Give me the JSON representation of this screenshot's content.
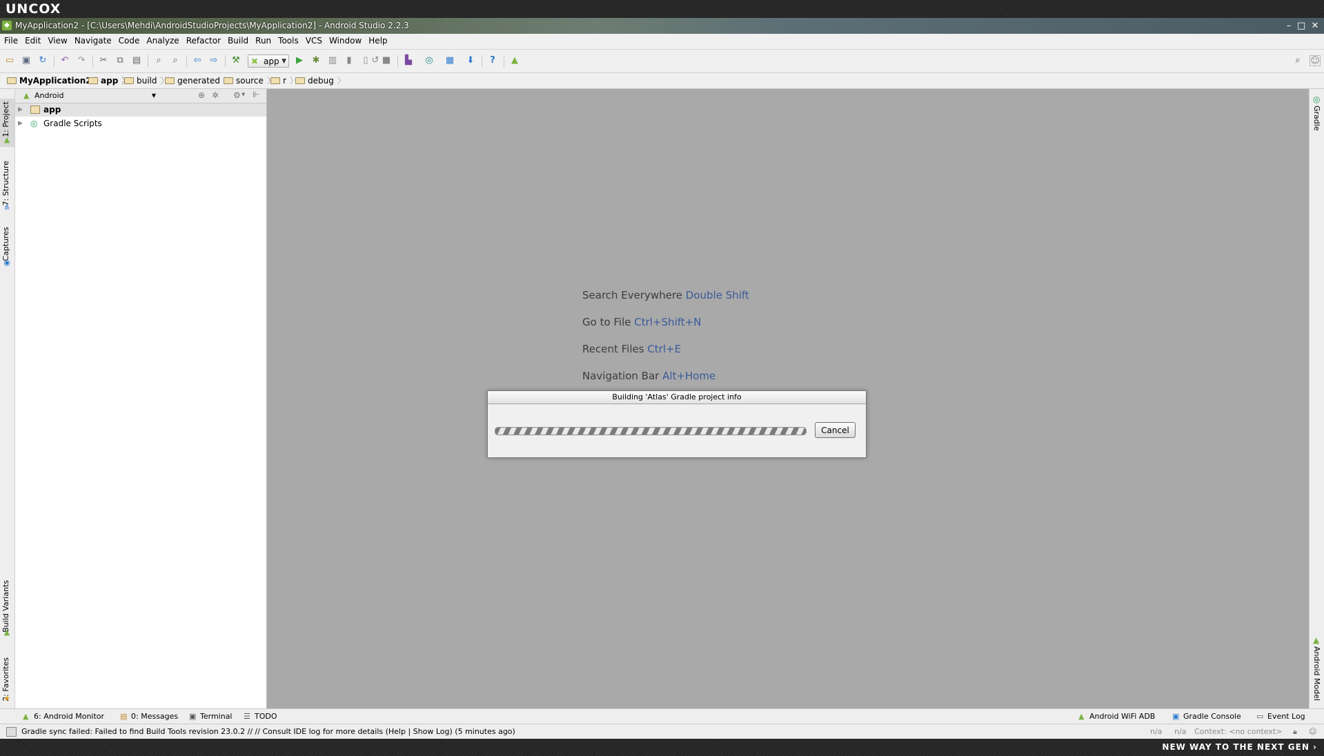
{
  "brand": {
    "logo": "UNCOX",
    "tagline": "NEW WAY TO THE NEXT GEN ›"
  },
  "window": {
    "title": "MyApplication2 - [C:\\Users\\Mehdi\\AndroidStudioProjects\\MyApplication2] - Android Studio 2.2.3",
    "controls": {
      "minimize": "–",
      "maximize": "□",
      "close": "✕"
    }
  },
  "menu": [
    "File",
    "Edit",
    "View",
    "Navigate",
    "Code",
    "Analyze",
    "Refactor",
    "Build",
    "Run",
    "Tools",
    "VCS",
    "Window",
    "Help"
  ],
  "toolbar": {
    "run_config": "app"
  },
  "breadcrumb": [
    "MyApplication2",
    "app",
    "build",
    "generated",
    "source",
    "r",
    "debug"
  ],
  "left_tabs": {
    "project": "1: Project",
    "structure": "7: Structure",
    "captures": "Captures",
    "build_variants": "Build Variants",
    "favorites": "2: Favorites"
  },
  "right_tabs": {
    "gradle": "Gradle",
    "android_model": "Android Model"
  },
  "project_panel": {
    "view": "Android",
    "tree": [
      {
        "label": "app"
      },
      {
        "label": "Gradle Scripts"
      }
    ]
  },
  "editor_hints": [
    {
      "text": "Search Everywhere",
      "key": "Double Shift"
    },
    {
      "text": "Go to File",
      "key": "Ctrl+Shift+N"
    },
    {
      "text": "Recent Files",
      "key": "Ctrl+E"
    },
    {
      "text": "Navigation Bar",
      "key": "Alt+Home"
    }
  ],
  "dialog": {
    "title": "Building 'Atlas' Gradle project info",
    "cancel": "Cancel",
    "progress": "indeterminate"
  },
  "bottom_tabs": {
    "left": [
      "6: Android Monitor",
      "0: Messages",
      "Terminal",
      "TODO"
    ],
    "right": [
      "Android WiFi ADB",
      "Gradle Console",
      "Event Log"
    ]
  },
  "status": {
    "message": "Gradle sync failed: Failed to find Build Tools revision 23.0.2 // // Consult IDE log for more details (Help | Show Log) (5 minutes ago)",
    "pos1": "n/a",
    "pos2": "n/a",
    "context": "Context: <no context>"
  },
  "colors": {
    "editor_bg": "#a9a9a9",
    "hint_key": "#3a5a99",
    "android_green": "#8bc34a"
  }
}
